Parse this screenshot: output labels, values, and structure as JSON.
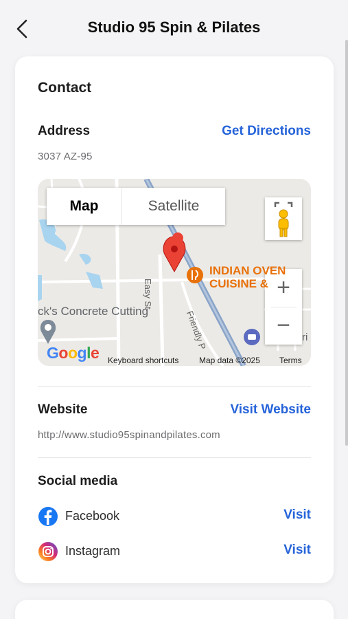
{
  "header": {
    "title": "Studio 95 Spin & Pilates"
  },
  "contact": {
    "section_title": "Contact",
    "address": {
      "label": "Address",
      "value": "3037 AZ-95",
      "action": "Get Directions"
    },
    "map": {
      "map_type_map": "Map",
      "map_type_satellite": "Satellite",
      "zoom_in": "+",
      "zoom_out": "−",
      "place_label": "ck's Concrete Cutting",
      "poi_line1": "INDIAN OVEN",
      "poi_line2": "CUISINE &",
      "street1": "Easy St",
      "street2": "Friendly P",
      "partial_label": "ri",
      "google": "Google",
      "keyboard_shortcuts": "Keyboard shortcuts",
      "map_data": "Map data ©2025",
      "terms": "Terms"
    },
    "website": {
      "label": "Website",
      "value": "http://www.studio95spinandpilates.com",
      "action": "Visit Website"
    },
    "social": {
      "label": "Social media",
      "items": [
        {
          "name": "Facebook",
          "action": "Visit"
        },
        {
          "name": "Instagram",
          "action": "Visit"
        }
      ]
    }
  },
  "colors": {
    "accent": "#2563d9",
    "pin": "#ea4335",
    "poi": "#e8710a"
  }
}
